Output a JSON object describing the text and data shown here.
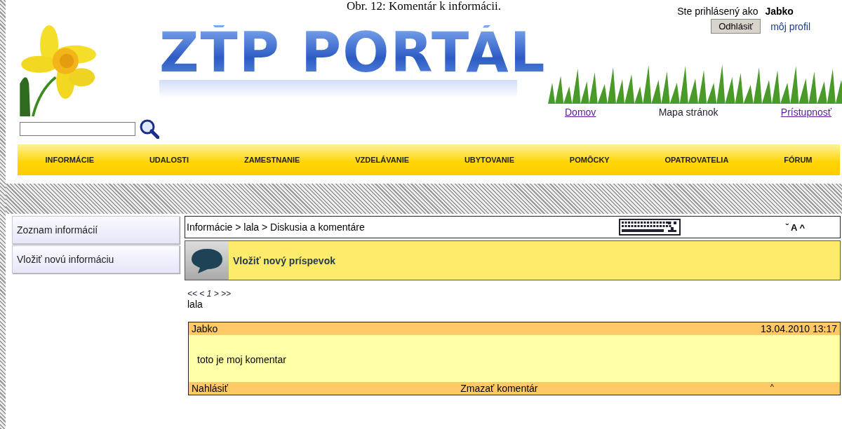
{
  "caption": "Obr. 12: Komentár k informácii.",
  "user_info": {
    "label": "Ste prihlásený ako",
    "username": "Jabko",
    "logout_button": "Odhlásiť",
    "profile_link": "môj profil"
  },
  "logo": "ZŤP PORTÁL",
  "top_links": [
    {
      "label": "Domov",
      "kind": "link"
    },
    {
      "label": "Mapa stránok",
      "kind": "plain"
    },
    {
      "label": "Prístupnosť",
      "kind": "link"
    }
  ],
  "nav": [
    "INFORMÁCIE",
    "UDALOSTI",
    "ZAMESTNANIE",
    "VZDELÁVANIE",
    "UBYTOVANIE",
    "POMÔCKY",
    "OPATROVATELIA",
    "FÓRUM"
  ],
  "sidebar": [
    "Zoznam informácií",
    "Vložiť novú informáciu"
  ],
  "breadcrumb": "Informácie > lala > Diskusia a komentáre",
  "text_size": "ˇ A ^",
  "new_post": "Vložiť nový príspevok",
  "pager": "<< < 1 > >>",
  "topic": "lala",
  "comments": [
    {
      "author": "Jabko",
      "date": "13.04.2010 13:17",
      "body": "toto je moj komentar",
      "report": "Nahlásiť",
      "delete": "Zmazať komentár",
      "up": "^"
    }
  ]
}
